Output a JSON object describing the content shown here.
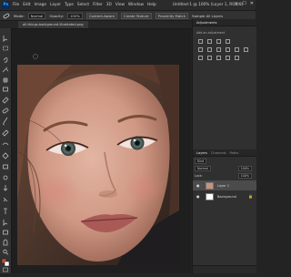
{
  "app": {
    "logo": "Ps"
  },
  "menu": [
    "File",
    "Edit",
    "Image",
    "Layer",
    "Type",
    "Select",
    "Filter",
    "3D",
    "View",
    "Window",
    "Help"
  ],
  "title": "Untitled-1 @ 100% (Layer 1, RGB/8)",
  "window_controls": [
    "—",
    "☐",
    "✕"
  ],
  "options_bar": {
    "mode_label": "Mode:",
    "mode_value": "Normal",
    "opacity_label": "Opacity:",
    "opacity_value": "100%",
    "buttons": [
      "Content-Aware",
      "Create Texture",
      "Proximity Match"
    ],
    "sample_label": "Sample All Layers"
  },
  "document_tab": "all-things-background-illustrated.png",
  "adjustments": {
    "tabs": [
      "Adjustments"
    ],
    "subtitle": "Add an adjustment"
  },
  "layers_panel": {
    "tabs": [
      "Layers",
      "Channels",
      "Paths"
    ],
    "kind_label": "Kind",
    "blend_mode": "Normal",
    "opacity_value": "100%",
    "lock_label": "Lock:",
    "fill_value": "100%",
    "layers": [
      {
        "name": "Layer 1",
        "icon": "photo-thumbnail",
        "selected": true
      },
      {
        "name": "Background",
        "icon": "white-thumbnail",
        "selected": false,
        "locked": true
      }
    ]
  },
  "colors": {
    "ui_dark": "#232323",
    "panel": "#303030",
    "accent": "#31a8ff",
    "selected_layer": "#4b4b4b"
  }
}
